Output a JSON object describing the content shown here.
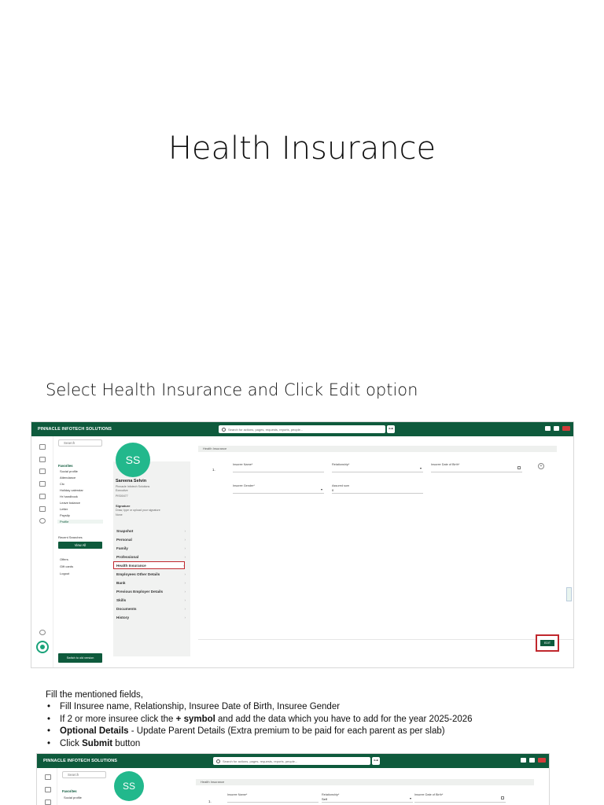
{
  "slide": {
    "title": "Health Insurance",
    "section_heading": "Select Health Insurance and Click Edit option"
  },
  "app": {
    "brand": "PINNACLE INFOTECH SOLUTIONS",
    "search_placeholder": "Search for actions, pages, requests, reports, people...",
    "left_search_placeholder": "Search",
    "favorites_title": "Favorites",
    "favorites": [
      "Social profile",
      "Attendance",
      "Ctc",
      "Holiday calendar",
      "Hr handbook",
      "Leave balance",
      "Letter",
      "Payslip",
      "Profile"
    ],
    "recent_searches_title": "Recent Searches",
    "view_all_label": "View All",
    "misc_links": [
      "Offers",
      "Gift cards",
      "Logout"
    ],
    "switch_label": "Switch to old version"
  },
  "profile": {
    "initials": "SS",
    "name": "Sareena Selvin",
    "company": "Pinnacle Infotech Solutions",
    "role": "Executive",
    "employee_id": "PIS00477",
    "signature_title": "Signature",
    "signature_hint": "Draw, type or upload your signature",
    "signature_value": "None",
    "menu": [
      "Snapshot",
      "Personal",
      "Family",
      "Professional",
      "Health Insurance",
      "Employees Other Details",
      "Bank",
      "Previous Employer Details",
      "Skills",
      "Documents",
      "History"
    ],
    "active_menu": "Health Insurance"
  },
  "form": {
    "header": "Health Insurance",
    "row_number": "1.",
    "insuree_name_label": "Insuree Name*",
    "relationship_label": "Relationship*",
    "relationship_value": "Self",
    "dob_label": "Insuree Date of Birth*",
    "gender_label": "Insuree Gender*",
    "assured_sum_label": "Assured sum",
    "assured_sum_value": "0",
    "edit_label": "EDIT"
  },
  "instructions": {
    "intro": "Fill the mentioned fields,",
    "b1": "Fill Insuree name, Relationship, Insuree Date of Birth, Insuree Gender",
    "b2_pre": "If 2 or more insuree click the ",
    "b2_bold": "+ symbol",
    "b2_post": " and add the data which you have to add for the year 2025-2026",
    "b3_bold": "Optional Details",
    "b3_post": " - Update Parent Details (Extra premium to be paid for each parent as per slab)",
    "b4_pre": "Click ",
    "b4_bold": "Submit",
    "b4_post": " button"
  },
  "colors": {
    "brand_green": "#0e5a3c",
    "accent_teal": "#22b88c",
    "highlight_red": "#c0272d"
  }
}
